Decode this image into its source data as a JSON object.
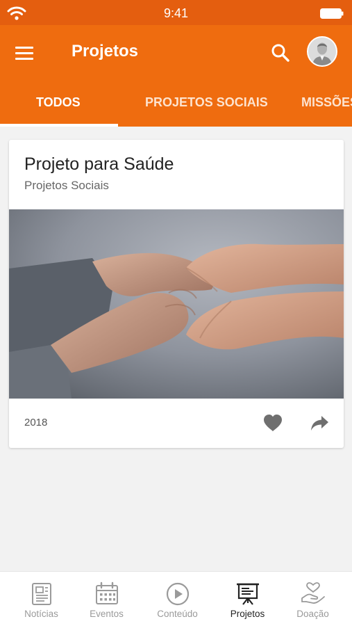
{
  "status_bar": {
    "time": "9:41"
  },
  "app_bar": {
    "title": "Projetos"
  },
  "tabs": [
    {
      "label": "TODOS",
      "active": true
    },
    {
      "label": "PROJETOS SOCIAIS",
      "active": false
    },
    {
      "label": "MISSÕES",
      "active": false
    }
  ],
  "card": {
    "title": "Projeto para Saúde",
    "subtitle": "Projetos Sociais",
    "year": "2018",
    "image_icon": "holding-hands-photo"
  },
  "bottom_nav": [
    {
      "label": "Notícias",
      "icon": "newspaper-icon",
      "active": false
    },
    {
      "label": "Eventos",
      "icon": "calendar-icon",
      "active": false
    },
    {
      "label": "Conteúdo",
      "icon": "play-circle-icon",
      "active": false
    },
    {
      "label": "Projetos",
      "icon": "presentation-board-icon",
      "active": true
    },
    {
      "label": "Doação",
      "icon": "heart-hand-icon",
      "active": false
    }
  ],
  "colors": {
    "primary": "#ef6c0f",
    "status_bar": "#e45e0f",
    "background": "#f2f2f2"
  }
}
